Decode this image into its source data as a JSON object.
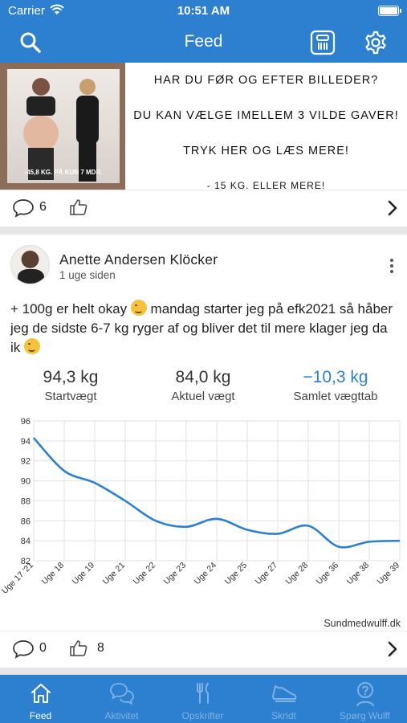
{
  "status_bar": {
    "carrier": "Carrier",
    "time": "10:51 AM"
  },
  "nav": {
    "title": "Feed",
    "icons": [
      "search-icon",
      "scale-icon",
      "gear-icon"
    ]
  },
  "promo": {
    "lines": [
      "HAR DU FØR OG EFTER BILLEDER?",
      "DU KAN VÆLGE IMELLEM 3 VILDE GAVER!",
      "TRYK HER OG LÆS MERE!",
      "- 15 KG. ELLER MERE!"
    ],
    "photo_caption": "-45,8 KG. PÅ KUN 7 MDR.",
    "comment_count": "6"
  },
  "post": {
    "author": "Anette Andersen Klöcker",
    "time_ago": "1 uge siden",
    "text_part1": "+ 100g er helt okay",
    "text_part2": "mandag starter jeg på efk2021 så håber jeg de sidste 6-7 kg ryger af og bliver det til mere klager jeg da ik",
    "stats": {
      "start_value": "94,3 kg",
      "start_label": "Startvægt",
      "current_value": "84,0 kg",
      "current_label": "Aktuel vægt",
      "loss_value": "−10,3 kg",
      "loss_label": "Samlet vægttab"
    },
    "credit": "Sundmedwulff.dk",
    "comment_count": "0",
    "like_count": "8"
  },
  "chart_data": {
    "type": "line",
    "categories": [
      "Uge 17 '21",
      "Uge 18",
      "Uge 19",
      "Uge 21",
      "Uge 22",
      "Uge 23",
      "Uge 24",
      "Uge 25",
      "Uge 27",
      "Uge 28",
      "Uge 36",
      "Uge 38",
      "Uge 39"
    ],
    "series": [
      {
        "values": [
          94.3,
          91.0,
          89.8,
          88.0,
          86.0,
          85.4,
          86.2,
          85.1,
          84.7,
          85.5,
          83.4,
          83.9,
          84.0
        ]
      }
    ],
    "ylim": [
      82,
      96
    ],
    "yticks": [
      82,
      84,
      86,
      88,
      90,
      92,
      94,
      96
    ],
    "grid": true,
    "color": "#2d80cf"
  },
  "tabs": [
    {
      "label": "Feed",
      "icon": "home-icon",
      "active": true
    },
    {
      "label": "Aktivitet",
      "icon": "chat-bubbles-icon",
      "active": false
    },
    {
      "label": "Opskrifter",
      "icon": "fork-knife-icon",
      "active": false
    },
    {
      "label": "Skridt",
      "icon": "shoe-icon",
      "active": false
    },
    {
      "label": "Spørg Wulff",
      "icon": "question-person-icon",
      "active": false
    }
  ],
  "colors": {
    "primary": "#2d80cf",
    "background": "#e6e6e6",
    "tab_inactive": "#7fb2e3"
  }
}
